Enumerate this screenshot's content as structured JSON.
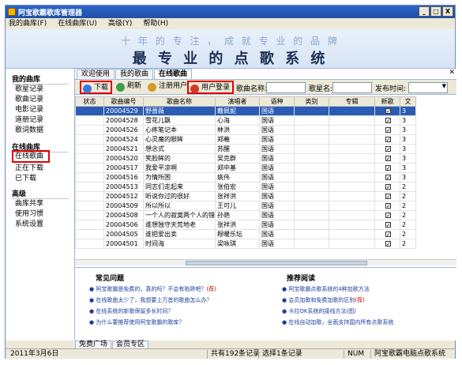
{
  "window": {
    "title": "阿宝歌霸歌库管理器",
    "buttons": [
      "_",
      "□",
      "X"
    ]
  },
  "menu": [
    "我的曲库(F)",
    "在线曲库(U)",
    "高级(Y)",
    "帮助(H)"
  ],
  "banner": {
    "line1": "十 年 的 专 注 ， 成 就 专 业 的 品 牌",
    "line2": "最 专 业 的 点 歌 系 统"
  },
  "sidebar": {
    "section1": "我的曲库",
    "items1": [
      "歌星记录",
      "歌曲记录",
      "电影记录",
      "道册记录",
      "歌词数据"
    ],
    "section2": "在线曲库",
    "items2": [
      "在线歌曲",
      "正在下载",
      "已下载"
    ],
    "section3": "高级",
    "items3": [
      "曲库共享",
      "使用习惯",
      "系统设置"
    ]
  },
  "tabs": [
    "欢迎使用",
    "我的歌曲",
    "在线歌曲"
  ],
  "toolbar": {
    "download": "下载",
    "refresh": "刷新",
    "register": "注册用户",
    "login": "用户登录",
    "song_name_label": "歌曲名称:",
    "singer_label": "歌星名:",
    "publish_label": "发布时间:"
  },
  "table": {
    "columns": [
      "状态",
      "歌曲编号",
      "歌曲名称",
      "演唱者",
      "语种",
      "类别",
      "专辑",
      "新歌",
      "文"
    ],
    "rows": [
      {
        "id": "20004529",
        "name": "野蔷薇",
        "singer": "戴佩妮",
        "lang": "国语",
        "extra": "3",
        "selected": true
      },
      {
        "id": "20004528",
        "name": "雪花儿飘",
        "singer": "心海",
        "lang": "国语",
        "extra": "3"
      },
      {
        "id": "20004526",
        "name": "心疼笔记本",
        "singer": "林洪",
        "lang": "国语",
        "extra": "3"
      },
      {
        "id": "20004524",
        "name": "心灵魔的眼眸",
        "singer": "郑羲",
        "lang": "国语",
        "extra": "3"
      },
      {
        "id": "20004521",
        "name": "想念式",
        "singer": "苏醒",
        "lang": "国语",
        "extra": "3"
      },
      {
        "id": "20004520",
        "name": "笑脸眸的",
        "singer": "吴克群",
        "lang": "国语",
        "extra": "3"
      },
      {
        "id": "20004517",
        "name": "我爱平凉啊",
        "singer": "郑中基",
        "lang": "国语",
        "extra": "3"
      },
      {
        "id": "20004516",
        "name": "为情所困",
        "singer": "姚伟",
        "lang": "国语",
        "extra": "3"
      },
      {
        "id": "20004513",
        "name": "同志们走起来",
        "singer": "张伯宏",
        "lang": "国语",
        "extra": "2"
      },
      {
        "id": "20004512",
        "name": "听说你过的很好",
        "singer": "张祥洪",
        "lang": "国语",
        "extra": "2"
      },
      {
        "id": "20004509",
        "name": "所以所以",
        "singer": "王可儿",
        "lang": "国语",
        "extra": "2"
      },
      {
        "id": "20004508",
        "name": "一个人的寂寞两个人的错",
        "singer": "孙艳",
        "lang": "国语",
        "extra": "2"
      },
      {
        "id": "20004506",
        "name": "谁想独守天荒地老",
        "singer": "张祥洪",
        "lang": "国语",
        "extra": "2"
      },
      {
        "id": "20004505",
        "name": "谁把爱出卖",
        "singer": "穆暖乐坛",
        "lang": "国语",
        "extra": "2"
      },
      {
        "id": "20004501",
        "name": "时间海",
        "singer": "梁咏琪",
        "lang": "国语",
        "extra": "2"
      }
    ]
  },
  "faq": {
    "title": "常见问题",
    "items": [
      {
        "text": "阿宝歌霸是免费的，真的吗？不会有陷阱吧？",
        "tag": "(荐)"
      },
      {
        "text": "在线歌曲太少了，我想要上万首的歌曲怎么办？",
        "tag": ""
      },
      {
        "text": "在线系统的新歌保留多长时间？",
        "tag": ""
      },
      {
        "text": "为什么要推荐使用阿宝歌霸的歌库？",
        "tag": ""
      }
    ]
  },
  "reading": {
    "title": "推荐阅读",
    "items": [
      {
        "text": "阿宝歌霸点歌系统的4种加歌方法",
        "tag": ""
      },
      {
        "text": "会员加歌和免费加歌的区别",
        "tag": "(荐)"
      },
      {
        "text": "卡拉OK系统的接线方法(图)",
        "tag": ""
      },
      {
        "text": "在线自动加歌，全面支持国内所有点歌系统",
        "tag": ""
      }
    ]
  },
  "bottom_tabs": [
    "免费广场",
    "会员专区"
  ],
  "status": {
    "date": "2011年3月6日",
    "total": "共有192条记录",
    "selected": "选择1条记录",
    "num": "NUM",
    "brand": "阿宝歌霸电脑点歌系统"
  },
  "colors": {
    "accent": "#2a5cb5",
    "highlight": "#e00000"
  }
}
